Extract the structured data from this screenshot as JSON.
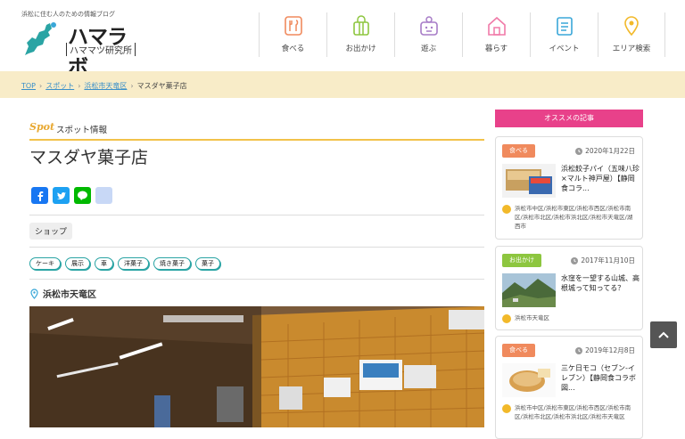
{
  "header": {
    "tagline": "浜松に住む人のための情報ブログ",
    "logo_text": "ハマラボ",
    "logo_sub": "ハママツ研究所"
  },
  "nav": [
    {
      "label": "食べる",
      "icon": "dining-icon",
      "color": "#f08a5d"
    },
    {
      "label": "お出かけ",
      "icon": "bag-icon",
      "color": "#8dc63f"
    },
    {
      "label": "遊ぶ",
      "icon": "play-icon",
      "color": "#a77cc7"
    },
    {
      "label": "暮らす",
      "icon": "house-icon",
      "color": "#f07aa8"
    },
    {
      "label": "イベント",
      "icon": "calendar-icon",
      "color": "#3aa7d8"
    },
    {
      "label": "エリア検索",
      "icon": "map-pin-icon",
      "color": "#f2b92a"
    }
  ],
  "breadcrumb": {
    "top": "TOP",
    "spot": "スポット",
    "area": "浜松市天竜区",
    "current": "マスダヤ菓子店"
  },
  "main": {
    "spot_script": "Spot",
    "spot_label": "スポット情報",
    "title": "マスダヤ菓子店",
    "category": "ショップ",
    "tags": [
      "ケーキ",
      "展示",
      "車",
      "洋菓子",
      "焼き菓子",
      "菓子"
    ],
    "area": "浜松市天竜区"
  },
  "sidebar": {
    "heading": "オススメの記事",
    "cards": [
      {
        "badge": "食べる",
        "badge_color": "#f08a5d",
        "date": "2020年1月22日",
        "title": "浜松餃子パイ（五味八珍×マルト神戸屋）【静岡食コラ...",
        "area": "浜松市中区/浜松市東区/浜松市西区/浜松市南区/浜松市北区/浜松市浜北区/浜松市天竜区/湖西市"
      },
      {
        "badge": "お出かけ",
        "badge_color": "#8dc63f",
        "date": "2017年11月10日",
        "title": "水窪を一望する山城、高根城って知ってる？",
        "area": "浜松市天竜区"
      },
      {
        "badge": "食べる",
        "badge_color": "#f08a5d",
        "date": "2019年12月8日",
        "title": "三ケ日モコ（セブン-イレブン）【静岡食コラボ図...",
        "area": "浜松市中区/浜松市東区/浜松市西区/浜松市南区/浜松市北区/浜松市浜北区/浜松市天竜区"
      }
    ]
  },
  "colors": {
    "accent_yellow": "#f2c24a",
    "breadcrumb_bg": "#f8ecc8",
    "sidebar_head": "#e8418a",
    "tag_border": "#2aa4a4"
  }
}
